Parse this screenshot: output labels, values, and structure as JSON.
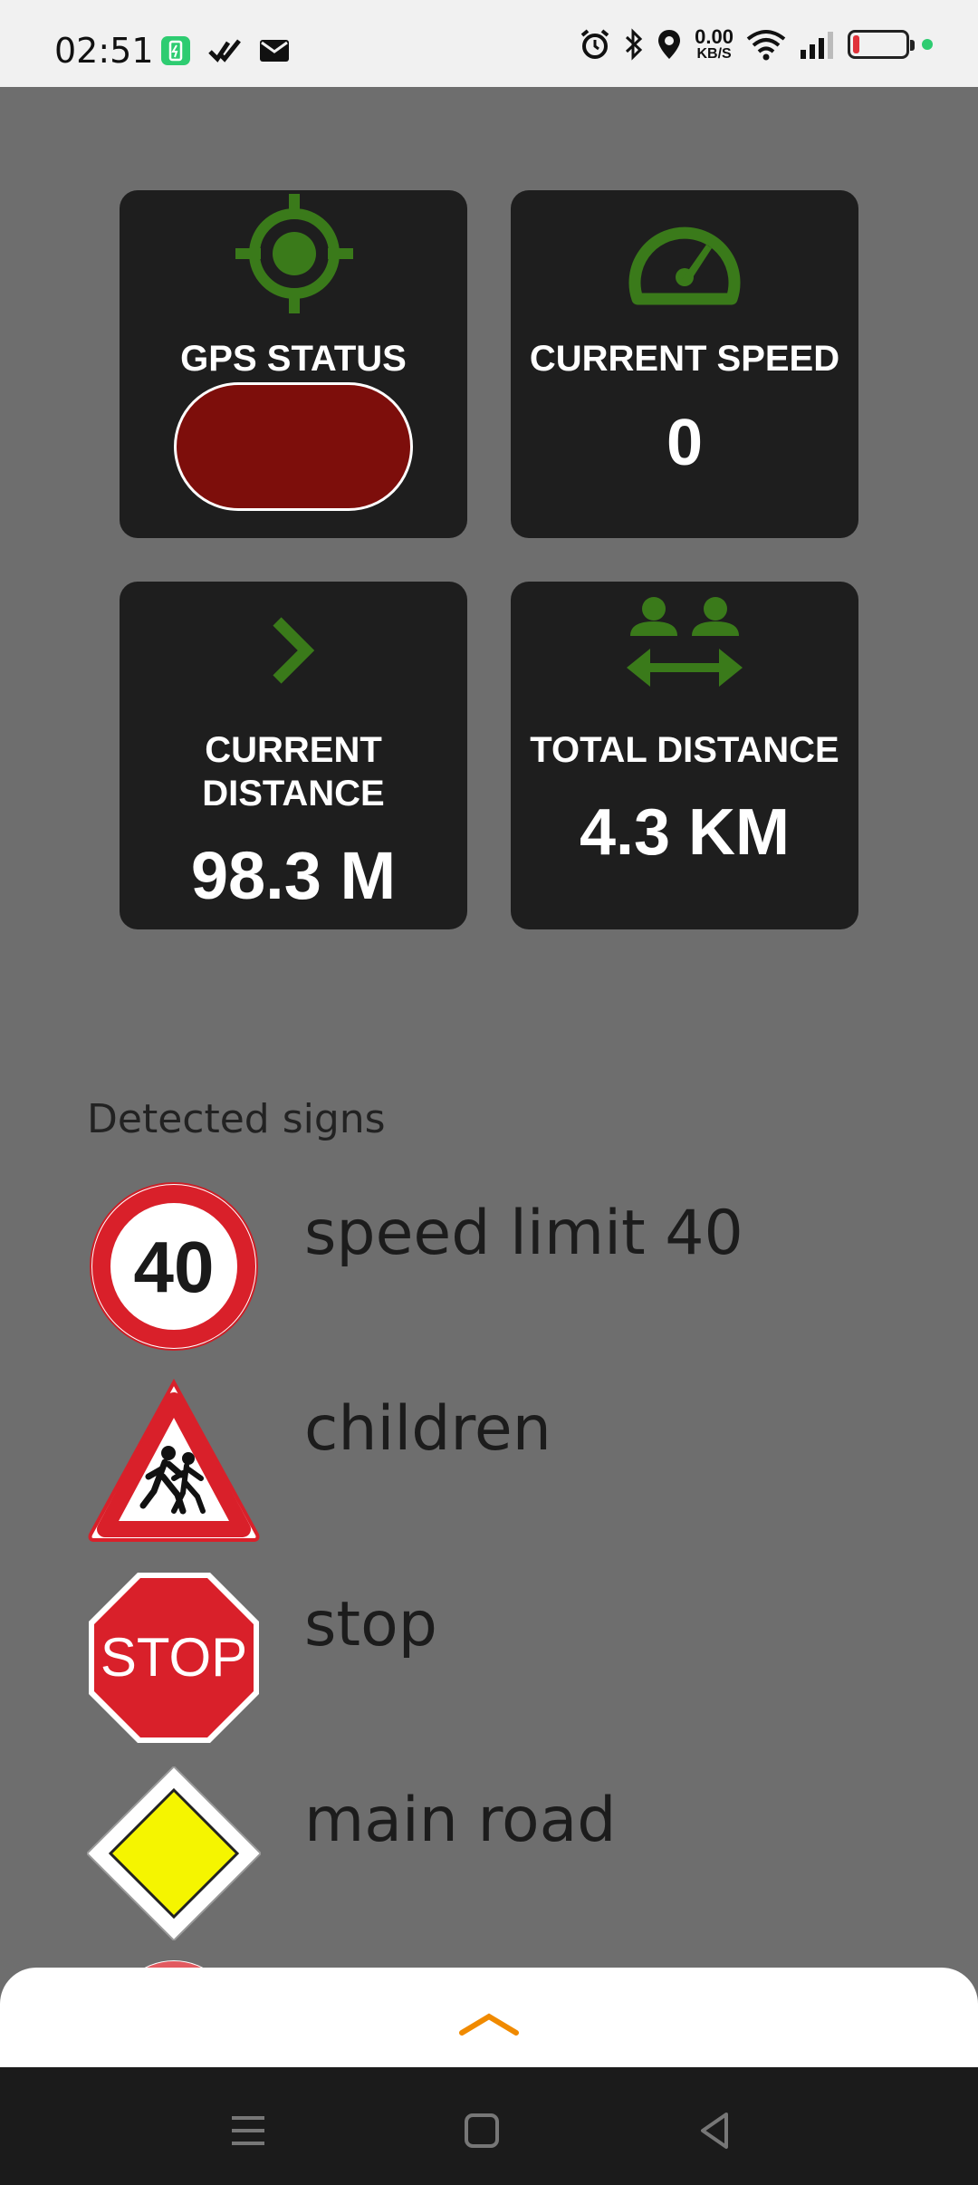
{
  "status_bar": {
    "time": "02:51",
    "net_speed_value": "0.00",
    "net_speed_unit": "KB/S",
    "left_icons": [
      "battery-saver-icon",
      "check-icon",
      "mail-icon"
    ],
    "right_icons": [
      "alarm-icon",
      "bluetooth-icon",
      "location-icon",
      "wifi-icon",
      "signal-icon",
      "battery-icon"
    ],
    "battery_level": 0.12,
    "colors": {
      "battery_low": "#e0323a",
      "dot": "#2ecc71"
    }
  },
  "tiles": {
    "gps": {
      "label": "GPS STATUS",
      "icon": "crosshair-icon",
      "state_color": "#7d0e0b"
    },
    "speed": {
      "label": "CURRENT SPEED",
      "value": "0",
      "icon": "speedometer-icon"
    },
    "current_distance": {
      "label_line1": "CURRENT",
      "label_line2": "DISTANCE",
      "value": "98.3 M",
      "icon": "chevron-right-icon"
    },
    "total_distance": {
      "label": "TOTAL DISTANCE",
      "value": "4.3 KM",
      "icon": "people-distance-icon"
    },
    "icon_color": "#3a7a1a"
  },
  "detected_signs": {
    "title": "Detected signs",
    "items": [
      {
        "label": "speed limit 40",
        "icon": "speed-limit-40-sign-icon",
        "sign_text": "40"
      },
      {
        "label": "children",
        "icon": "children-sign-icon"
      },
      {
        "label": "stop",
        "icon": "stop-sign-icon",
        "sign_text": "STOP"
      },
      {
        "label": "main road",
        "icon": "main-road-sign-icon"
      }
    ]
  },
  "bottom_sheet": {
    "icon": "chevron-up-icon",
    "accent": "#f08a00"
  },
  "nav_bar": {
    "icons": [
      "menu-icon",
      "home-icon",
      "back-icon"
    ]
  }
}
